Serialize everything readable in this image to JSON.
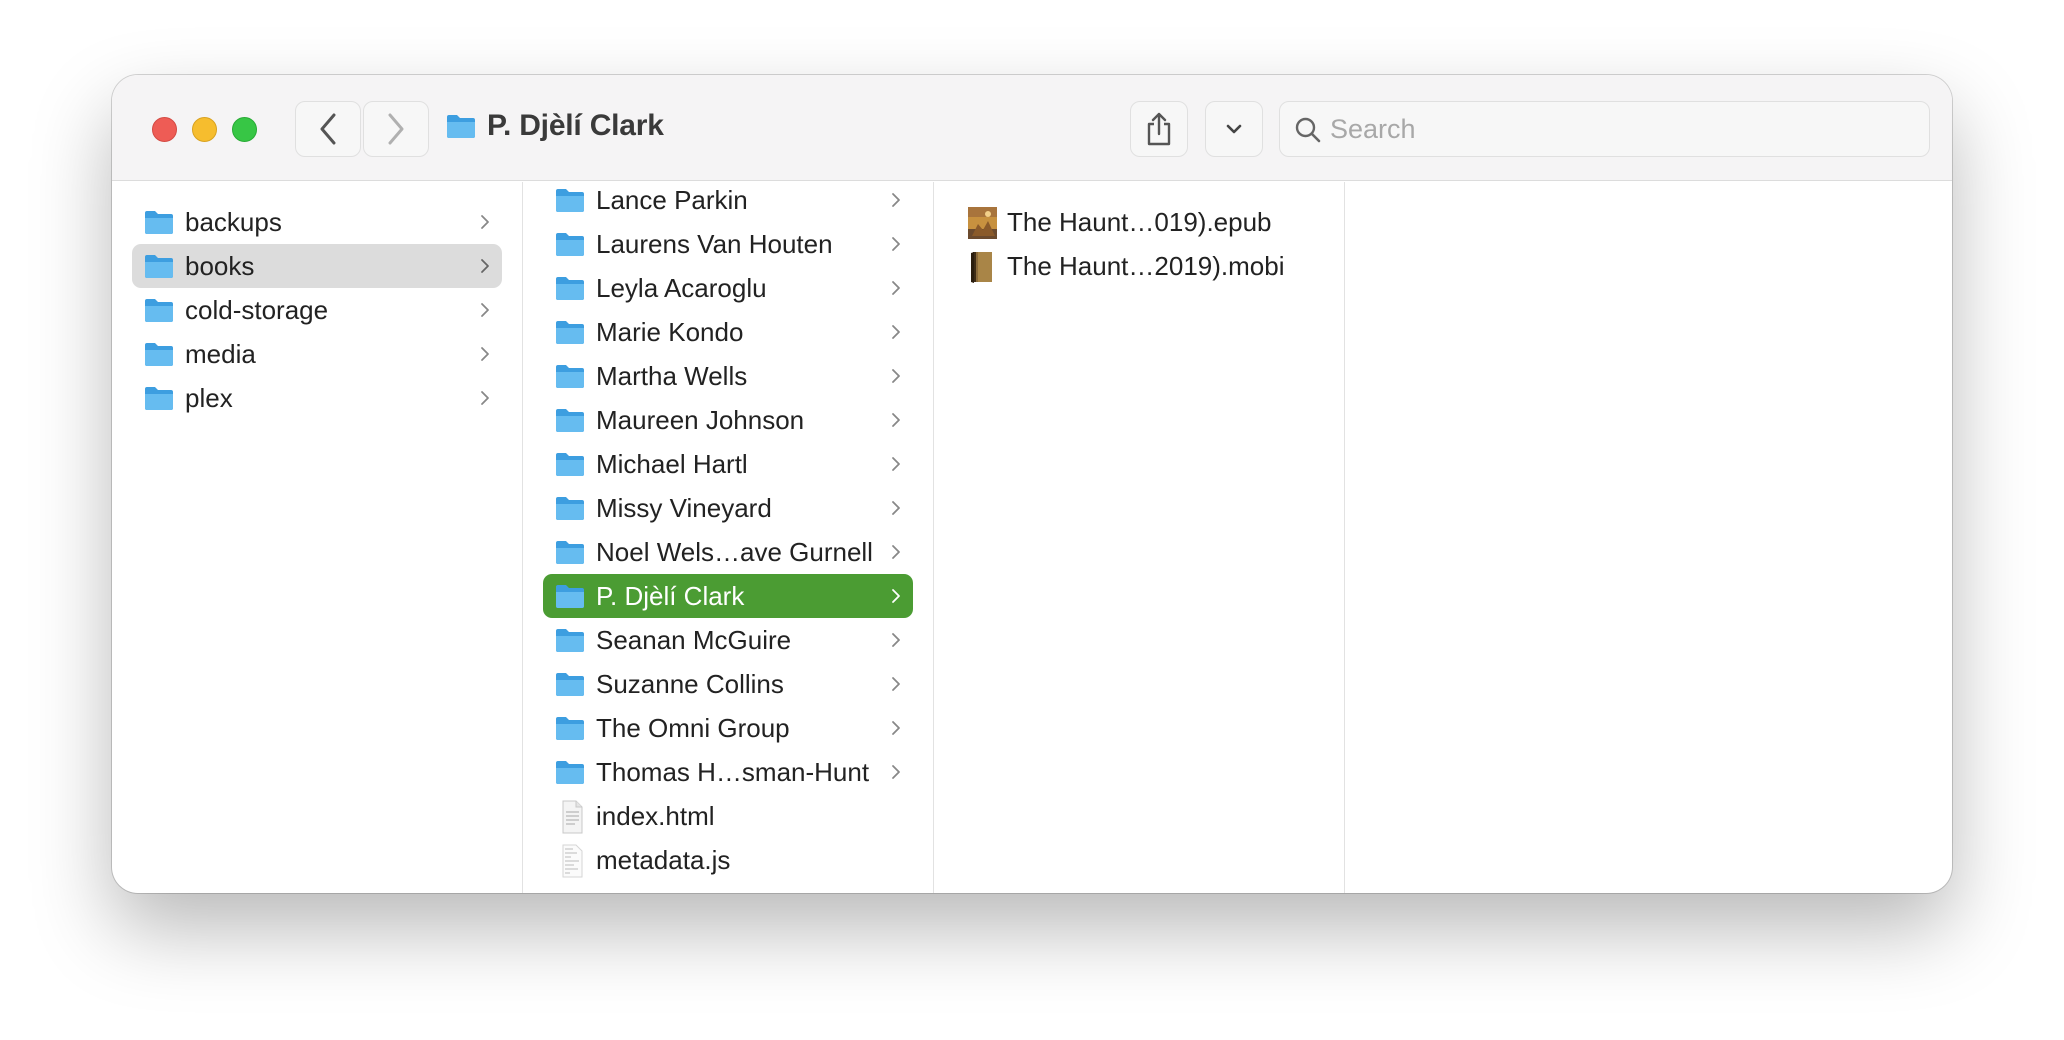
{
  "window": {
    "title": "P. Djèlí Clark"
  },
  "toolbar": {
    "back_icon": "chevron-left-icon",
    "forward_icon": "chevron-right-icon",
    "share_icon": "share-icon",
    "group_icon": "chevron-down-icon",
    "search_placeholder": "Search"
  },
  "colors": {
    "folder": "#5bb3ec",
    "selection_active": "#4b9c33",
    "selection_inactive": "#dcdcdc"
  },
  "column1": {
    "items": [
      {
        "label": "backups"
      },
      {
        "label": "books"
      },
      {
        "label": "cold-storage"
      },
      {
        "label": "media"
      },
      {
        "label": "plex"
      }
    ]
  },
  "column2": {
    "items": [
      {
        "label": "Lance Parkin"
      },
      {
        "label": "Laurens Van Houten"
      },
      {
        "label": "Leyla Acaroglu"
      },
      {
        "label": "Marie Kondo"
      },
      {
        "label": "Martha Wells"
      },
      {
        "label": "Maureen Johnson"
      },
      {
        "label": "Michael Hartl"
      },
      {
        "label": "Missy Vineyard"
      },
      {
        "label": "Noel Wels…ave Gurnell"
      },
      {
        "label": "P. Djèlí Clark"
      },
      {
        "label": "Seanan McGuire"
      },
      {
        "label": "Suzanne Collins"
      },
      {
        "label": "The Omni Group"
      },
      {
        "label": "Thomas H…sman-Hunt"
      },
      {
        "label": "index.html"
      },
      {
        "label": "metadata.js"
      }
    ]
  },
  "column3": {
    "items": [
      {
        "label": "The Haunt…019).epub"
      },
      {
        "label": "The Haunt…2019).mobi"
      }
    ]
  }
}
